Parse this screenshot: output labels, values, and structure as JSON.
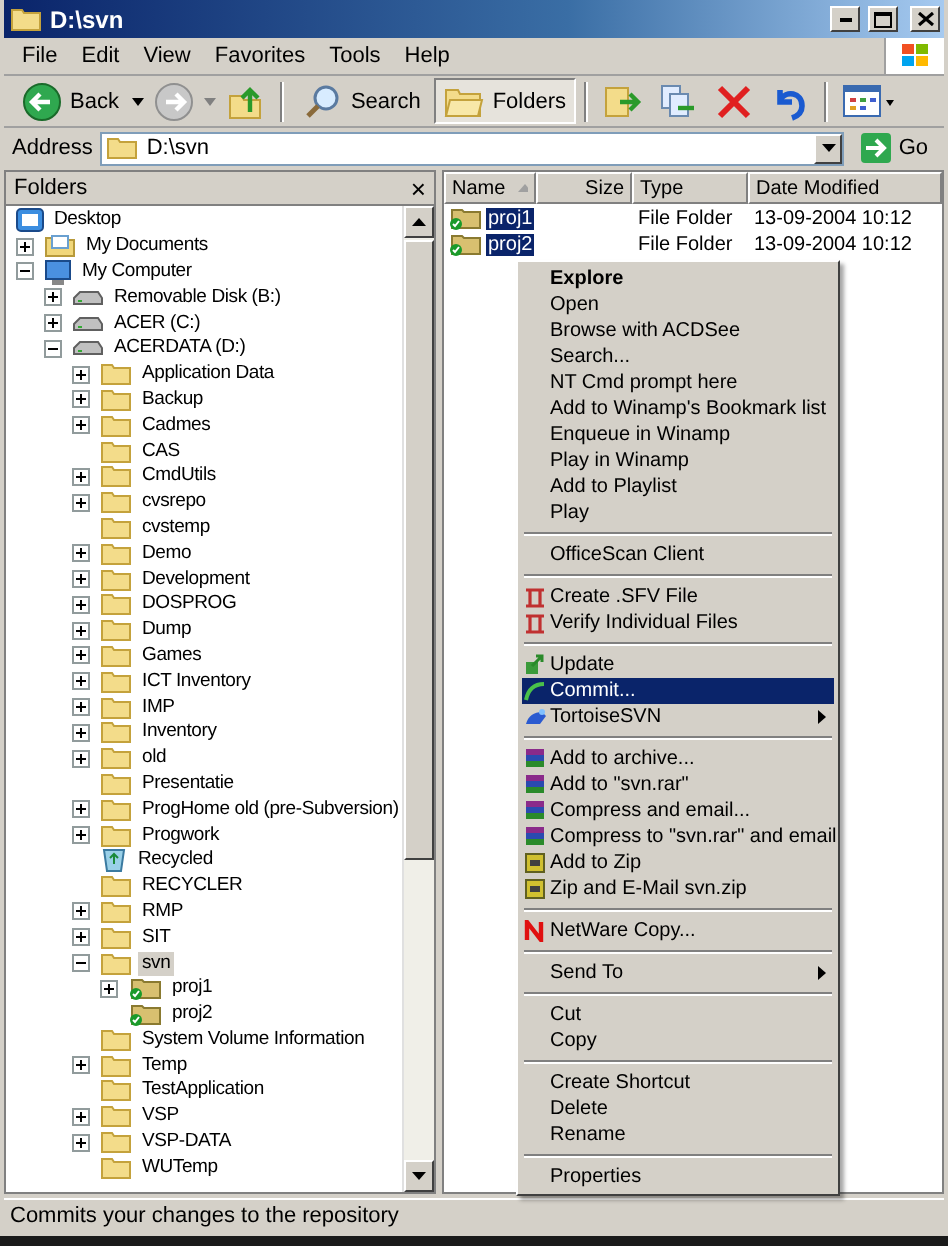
{
  "window": {
    "title": "D:\\svn"
  },
  "menu_bar": [
    {
      "label": "File"
    },
    {
      "label": "Edit"
    },
    {
      "label": "View"
    },
    {
      "label": "Favorites"
    },
    {
      "label": "Tools"
    },
    {
      "label": "Help"
    }
  ],
  "toolbar": [
    {
      "kind": "back",
      "label": "Back",
      "selected": false
    },
    {
      "kind": "forward",
      "selected": false
    },
    {
      "kind": "up",
      "selected": false
    },
    {
      "kind": "search",
      "label": "Search",
      "selected": false
    },
    {
      "kind": "folders",
      "label": "Folders",
      "selected": true
    },
    {
      "kind": "move",
      "selected": false
    },
    {
      "kind": "copy",
      "selected": false
    },
    {
      "kind": "delete",
      "selected": false
    },
    {
      "kind": "undo",
      "selected": false
    },
    {
      "kind": "views",
      "selected": false
    }
  ],
  "address": {
    "label": "Address",
    "value": "D:\\svn",
    "go": "Go"
  },
  "folders_pane": {
    "title": "Folders",
    "close": "×"
  },
  "tree": [
    {
      "label": "Desktop",
      "kind": "desktop",
      "selected": false,
      "children": [
        {
          "label": "My Documents",
          "kind": "documents",
          "expanded": false,
          "selected": false
        },
        {
          "label": "My Computer",
          "kind": "computer",
          "expanded": true,
          "selected": false,
          "children": [
            {
              "label": "Removable Disk (B:)",
              "kind": "drive",
              "expanded": false,
              "selected": false
            },
            {
              "label": "ACER (C:)",
              "kind": "drive",
              "expanded": false,
              "selected": false
            },
            {
              "label": "ACERDATA (D:)",
              "kind": "drive",
              "expanded": true,
              "selected": false,
              "children": [
                {
                  "label": "Application Data",
                  "kind": "folder",
                  "expanded": false,
                  "selected": false
                },
                {
                  "label": "Backup",
                  "kind": "folder",
                  "expanded": false,
                  "selected": false
                },
                {
                  "label": "Cadmes",
                  "kind": "folder",
                  "expanded": false,
                  "selected": false
                },
                {
                  "label": "CAS",
                  "kind": "folder",
                  "selected": false
                },
                {
                  "label": "CmdUtils",
                  "kind": "folder",
                  "expanded": false,
                  "selected": false
                },
                {
                  "label": "cvsrepo",
                  "kind": "folder",
                  "expanded": false,
                  "selected": false
                },
                {
                  "label": "cvstemp",
                  "kind": "folder",
                  "selected": false
                },
                {
                  "label": "Demo",
                  "kind": "folder",
                  "expanded": false,
                  "selected": false
                },
                {
                  "label": "Development",
                  "kind": "folder",
                  "expanded": false,
                  "selected": false
                },
                {
                  "label": "DOSPROG",
                  "kind": "folder",
                  "expanded": false,
                  "selected": false
                },
                {
                  "label": "Dump",
                  "kind": "folder",
                  "expanded": false,
                  "selected": false
                },
                {
                  "label": "Games",
                  "kind": "folder",
                  "expanded": false,
                  "selected": false
                },
                {
                  "label": "ICT Inventory",
                  "kind": "folder",
                  "expanded": false,
                  "selected": false
                },
                {
                  "label": "IMP",
                  "kind": "folder",
                  "expanded": false,
                  "selected": false
                },
                {
                  "label": "Inventory",
                  "kind": "folder",
                  "expanded": false,
                  "selected": false
                },
                {
                  "label": "old",
                  "kind": "folder",
                  "expanded": false,
                  "selected": false
                },
                {
                  "label": "Presentatie",
                  "kind": "folder",
                  "selected": false
                },
                {
                  "label": "ProgHome old (pre-Subversion)",
                  "kind": "folder",
                  "expanded": false,
                  "selected": false
                },
                {
                  "label": "Progwork",
                  "kind": "folder",
                  "expanded": false,
                  "selected": false
                },
                {
                  "label": "Recycled",
                  "kind": "recycle",
                  "selected": false
                },
                {
                  "label": "RECYCLER",
                  "kind": "folder",
                  "selected": false
                },
                {
                  "label": "RMP",
                  "kind": "folder",
                  "expanded": false,
                  "selected": false
                },
                {
                  "label": "SIT",
                  "kind": "folder",
                  "expanded": false,
                  "selected": false
                },
                {
                  "label": "svn",
                  "kind": "folder",
                  "expanded": true,
                  "selected": true,
                  "children": [
                    {
                      "label": "proj1",
                      "kind": "versioned",
                      "expanded": false,
                      "selected": false
                    },
                    {
                      "label": "proj2",
                      "kind": "versioned",
                      "selected": false
                    }
                  ]
                },
                {
                  "label": "System Volume Information",
                  "kind": "folder",
                  "selected": false
                },
                {
                  "label": "Temp",
                  "kind": "folder",
                  "expanded": false,
                  "selected": false
                },
                {
                  "label": "TestApplication",
                  "kind": "folder",
                  "selected": false
                },
                {
                  "label": "VSP",
                  "kind": "folder",
                  "expanded": false,
                  "selected": false
                },
                {
                  "label": "VSP-DATA",
                  "kind": "folder",
                  "expanded": false,
                  "selected": false
                },
                {
                  "label": "WUTemp",
                  "kind": "folder",
                  "selected": false
                }
              ]
            }
          ]
        }
      ]
    }
  ],
  "file_list": {
    "columns": [
      {
        "label": "Name",
        "sorted": true
      },
      {
        "label": "Size",
        "sorted": false
      },
      {
        "label": "Type",
        "sorted": false
      },
      {
        "label": "Date Modified",
        "sorted": false
      }
    ],
    "rows": [
      {
        "name": "proj1",
        "type": "File Folder",
        "modified": "13-09-2004 10:12",
        "selected": true
      },
      {
        "name": "proj2",
        "type": "File Folder",
        "modified": "13-09-2004 10:12",
        "selected": true
      }
    ]
  },
  "context_menu": {
    "items": [
      {
        "kind": "default",
        "label": "Explore",
        "selected": false
      },
      {
        "kind": "plain",
        "label": "Open",
        "selected": false
      },
      {
        "kind": "plain",
        "label": "Browse with ACDSee",
        "selected": false
      },
      {
        "kind": "plain",
        "label": "Search...",
        "selected": false
      },
      {
        "kind": "plain",
        "label": "NT Cmd prompt here",
        "selected": false
      },
      {
        "kind": "plain",
        "label": "Add to Winamp's Bookmark list",
        "selected": false
      },
      {
        "kind": "plain",
        "label": "Enqueue in Winamp",
        "selected": false
      },
      {
        "kind": "plain",
        "label": "Play in Winamp",
        "selected": false
      },
      {
        "kind": "plain",
        "label": "Add to Playlist",
        "selected": false
      },
      {
        "kind": "plain",
        "label": "Play",
        "selected": false
      },
      {
        "kind": "separator"
      },
      {
        "kind": "plain",
        "label": "OfficeScan Client",
        "selected": false
      },
      {
        "kind": "separator"
      },
      {
        "kind": "sfv",
        "label": "Create .SFV File",
        "selected": false
      },
      {
        "kind": "sfv",
        "label": "Verify Individual Files",
        "selected": false
      },
      {
        "kind": "separator"
      },
      {
        "kind": "update",
        "label": "Update",
        "selected": false
      },
      {
        "kind": "commit",
        "label": "Commit...",
        "selected": true
      },
      {
        "kind": "tortoise",
        "label": "TortoiseSVN",
        "selected": false,
        "submenu": true
      },
      {
        "kind": "separator"
      },
      {
        "kind": "rar",
        "label": "Add to archive...",
        "selected": false
      },
      {
        "kind": "rar",
        "label": "Add to \"svn.rar\"",
        "selected": false
      },
      {
        "kind": "rar",
        "label": "Compress and email...",
        "selected": false
      },
      {
        "kind": "rar",
        "label": "Compress to \"svn.rar\" and email",
        "selected": false
      },
      {
        "kind": "zip",
        "label": "Add to Zip",
        "selected": false
      },
      {
        "kind": "zip",
        "label": "Zip and E-Mail svn.zip",
        "selected": false
      },
      {
        "kind": "separator"
      },
      {
        "kind": "netware",
        "label": "NetWare Copy...",
        "selected": false
      },
      {
        "kind": "separator"
      },
      {
        "kind": "plain",
        "label": "Send To",
        "selected": false,
        "submenu": true
      },
      {
        "kind": "separator"
      },
      {
        "kind": "plain",
        "label": "Cut",
        "selected": false
      },
      {
        "kind": "plain",
        "label": "Copy",
        "selected": false
      },
      {
        "kind": "separator"
      },
      {
        "kind": "plain",
        "label": "Create Shortcut",
        "selected": false
      },
      {
        "kind": "plain",
        "label": "Delete",
        "selected": false
      },
      {
        "kind": "plain",
        "label": "Rename",
        "selected": false
      },
      {
        "kind": "separator"
      },
      {
        "kind": "plain",
        "label": "Properties",
        "selected": false
      }
    ]
  },
  "status_bar": "Commits your changes to the repository"
}
